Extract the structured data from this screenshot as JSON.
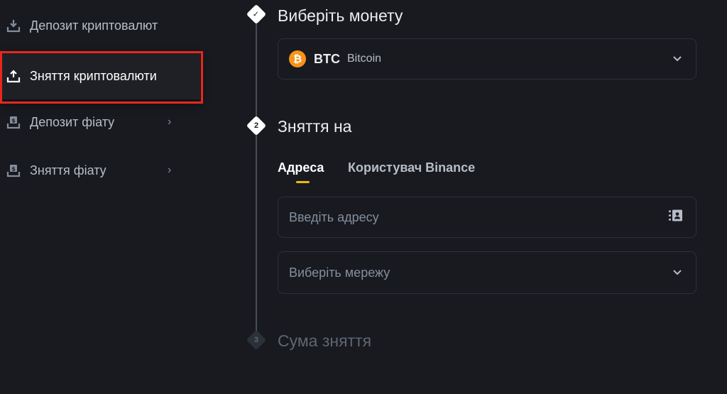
{
  "sidebar": {
    "items": [
      {
        "label": "Депозит криптовалют",
        "icon": "download-icon",
        "has_chevron": false
      },
      {
        "label": "Зняття криптовалюти",
        "icon": "upload-icon",
        "has_chevron": false,
        "active": true
      },
      {
        "label": "Депозит фіату",
        "icon": "deposit-fiat-icon",
        "has_chevron": true
      },
      {
        "label": "Зняття фіату",
        "icon": "withdraw-fiat-icon",
        "has_chevron": true
      }
    ]
  },
  "steps": [
    {
      "marker": "✓",
      "title": "Виберіть монету",
      "state": "done"
    },
    {
      "marker": "2",
      "title": "Зняття на",
      "state": "active"
    },
    {
      "marker": "3",
      "title": "Сума зняття",
      "state": "inactive"
    }
  ],
  "coin": {
    "icon_glyph": "₿",
    "symbol": "BTC",
    "name": "Bitcoin"
  },
  "tabs": [
    {
      "label": "Адреса",
      "active": true
    },
    {
      "label": "Користувач Binance",
      "active": false
    }
  ],
  "address_field": {
    "placeholder": "Введіть адресу",
    "icon": "address-book-icon"
  },
  "network_field": {
    "placeholder": "Виберіть мережу"
  },
  "colors": {
    "background": "#181a20",
    "accent": "#f0b90b",
    "btc": "#f7931a",
    "highlight": "#e8271c"
  }
}
